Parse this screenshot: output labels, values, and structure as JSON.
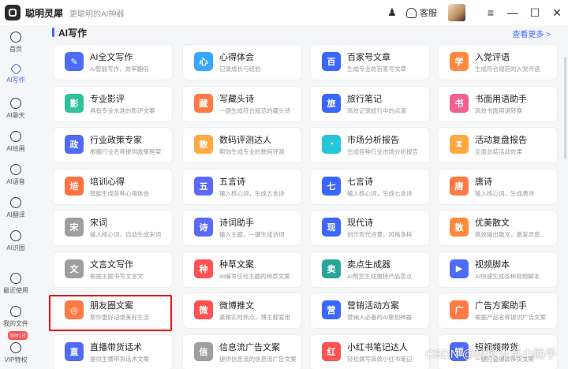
{
  "app": {
    "name": "聪明灵犀",
    "slogan": "更聪明的AI神器",
    "service_label": "客服"
  },
  "window_controls": [
    "≡",
    "—",
    "☐",
    "✕"
  ],
  "sidebar": {
    "items": [
      {
        "label": "首页",
        "icon": "home-icon"
      },
      {
        "label": "AI写作",
        "icon": "pen-icon",
        "active": true
      },
      {
        "label": "AI聊天",
        "icon": "chat-icon"
      },
      {
        "label": "AI绘画",
        "icon": "paint-icon"
      },
      {
        "label": "AI语音",
        "icon": "mic-icon"
      },
      {
        "label": "AI翻译",
        "icon": "translate-icon"
      },
      {
        "label": "AI识图",
        "icon": "scan-icon"
      },
      {
        "label": "最近使用",
        "icon": "clock-icon"
      },
      {
        "label": "我的文件",
        "icon": "folder-icon"
      },
      {
        "label": "VIP特权",
        "icon": "diamond-icon"
      }
    ],
    "vip_badge": "限时1折"
  },
  "section": {
    "title": "AI写作",
    "see_more": "查看更多 >"
  },
  "cards": [
    {
      "title": "AI全文写作",
      "desc": "AI智能写作，效率翻倍",
      "icon_text": "✎",
      "color": "#4f6cf7"
    },
    {
      "title": "心得体会",
      "desc": "记录成长与经验",
      "icon_text": "心",
      "color": "#3aa7ff"
    },
    {
      "title": "百家号文章",
      "desc": "生成专业的百家号文章",
      "icon_text": "百",
      "color": "#3b66ff"
    },
    {
      "title": "入党评语",
      "desc": "生成符合规范的入党评语",
      "icon_text": "学",
      "color": "#ff8a3d"
    },
    {
      "title": "专业影评",
      "desc": "具有专业水准的影评文案",
      "icon_text": "影",
      "color": "#2fc29b"
    },
    {
      "title": "写藏头诗",
      "desc": "一键生成符合规范的藏头诗",
      "icon_text": "藏",
      "color": "#ff7a45"
    },
    {
      "title": "旅行笔记",
      "desc": "高效记录旅行中的点滴",
      "icon_text": "旅",
      "color": "#3b66ff"
    },
    {
      "title": "书面用语助手",
      "desc": "高效书面用语转换",
      "icon_text": "书",
      "color": "#f06292"
    },
    {
      "title": "行业政策专家",
      "desc": "根据行业名称提供政策框架",
      "icon_text": "政",
      "color": "#4f6cf7"
    },
    {
      "title": "数码评测达人",
      "desc": "帮你生成专业的数码评测",
      "icon_text": "数",
      "color": "#ffa940"
    },
    {
      "title": "市场分析报告",
      "desc": "生成各种行业市场分析报告",
      "icon_text": "◔",
      "color": "#26c6da"
    },
    {
      "title": "活动复盘报告",
      "desc": "全面总结活动效果",
      "icon_text": "⧗",
      "color": "#ffa940"
    },
    {
      "title": "培训心得",
      "desc": "智能生成各种心得体会",
      "icon_text": "培",
      "color": "#ff7043"
    },
    {
      "title": "五言诗",
      "desc": "输入核心词，生成五言诗",
      "icon_text": "五",
      "color": "#5c6bf7"
    },
    {
      "title": "七言诗",
      "desc": "输入核心词，生成七言诗",
      "icon_text": "七",
      "color": "#3b66ff"
    },
    {
      "title": "唐诗",
      "desc": "输入核心词，生成唐诗",
      "icon_text": "唐",
      "color": "#ff7a45"
    },
    {
      "title": "宋词",
      "desc": "输入核心词，自动生成宋词",
      "icon_text": "宋",
      "color": "#9e9e9e"
    },
    {
      "title": "诗词助手",
      "desc": "输入主题，一键生成诗词",
      "icon_text": "诗",
      "color": "#5c6bf7"
    },
    {
      "title": "现代诗",
      "desc": "创作现代诗意，风格多样",
      "icon_text": "现",
      "color": "#3b66ff"
    },
    {
      "title": "优美散文",
      "desc": "高效输出散文，激发灵感",
      "icon_text": "散",
      "color": "#ff8a3d"
    },
    {
      "title": "文言文写作",
      "desc": "根据主题书写文言文",
      "icon_text": "文",
      "color": "#9e9e9e"
    },
    {
      "title": "种草文案",
      "desc": "AI编写任何主题的种草文案",
      "icon_text": "种",
      "color": "#ff5252"
    },
    {
      "title": "卖点生成器",
      "desc": "AI帮您生成独特产品卖点",
      "icon_text": "卖",
      "color": "#26a69a"
    },
    {
      "title": "视频脚本",
      "desc": "AI快速生成各种视频脚本",
      "icon_text": "▶",
      "color": "#4f6cf7"
    },
    {
      "title": "朋友圈文案",
      "desc": "帮你更好记录美好生活",
      "icon_text": "◎",
      "color": "#ff7a45"
    },
    {
      "title": "微博推文",
      "desc": "紧跟实时热点，博主都爱用",
      "icon_text": "微",
      "color": "#ff5252"
    },
    {
      "title": "营销活动方案",
      "desc": "营销人必备的AI策划神器",
      "icon_text": "营",
      "color": "#3b66ff"
    },
    {
      "title": "广告方案助手",
      "desc": "根据产品名称提供广告文案",
      "icon_text": "广",
      "color": "#ff7a45"
    },
    {
      "title": "直播带货话术",
      "desc": "提供生播带货话术文案",
      "icon_text": "直",
      "color": "#4f6cf7"
    },
    {
      "title": "信息流广告文案",
      "desc": "提供信息流的信息流广告文案",
      "icon_text": "信",
      "color": "#9e9e9e"
    },
    {
      "title": "小红书笔记达人",
      "desc": "轻松撰写高效小红书笔记",
      "icon_text": "红",
      "color": "#ff5252"
    },
    {
      "title": "短视频带货",
      "desc": "一键打造爆款带货文案",
      "icon_text": "短",
      "color": "#4f6cf7"
    }
  ],
  "watermark": "CSDN @科技分享小助手"
}
